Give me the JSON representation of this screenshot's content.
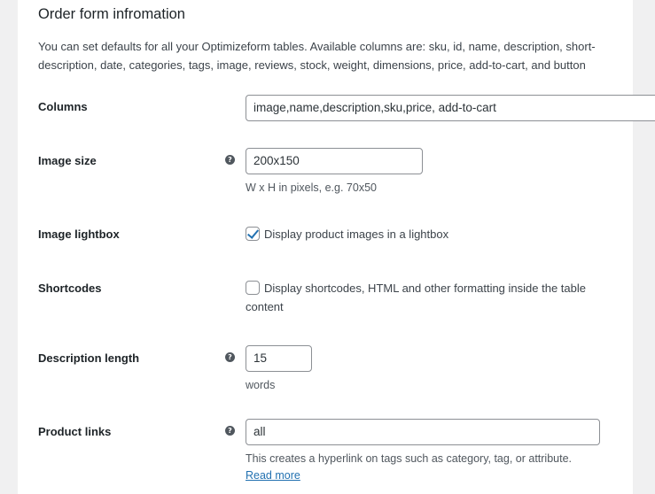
{
  "section": {
    "title": "Order form infromation",
    "intro": "You can set defaults for all your Optimizeform tables. Available columns are: sku, id, name, description, short-description, date, categories, tags, image, reviews, stock, weight, dimensions, price, add-to-cart, and button"
  },
  "fields": {
    "columns": {
      "label": "Columns",
      "value": "image,name,description,sku,price, add-to-cart"
    },
    "image_size": {
      "label": "Image size",
      "value": "200x150",
      "description": "W x H in pixels, e.g. 70x50"
    },
    "image_lightbox": {
      "label": "Image lightbox",
      "checkbox_label": "Display product images in a lightbox",
      "checked": true
    },
    "shortcodes": {
      "label": "Shortcodes",
      "checkbox_label": "Display shortcodes, HTML and other formatting inside the table content",
      "checked": false
    },
    "description_length": {
      "label": "Description length",
      "value": "15",
      "description": "words"
    },
    "product_links": {
      "label": "Product links",
      "value": "all",
      "description": "This creates a hyperlink on tags such as category, tag, or attribute.",
      "link_text": "Read more"
    }
  },
  "icons": {
    "help": "question-mark-circle-icon",
    "help_glyph": "?"
  },
  "colors": {
    "link": "#2271b1",
    "checkmark": "#2271b1",
    "page_bg": "#f0f0f1"
  }
}
